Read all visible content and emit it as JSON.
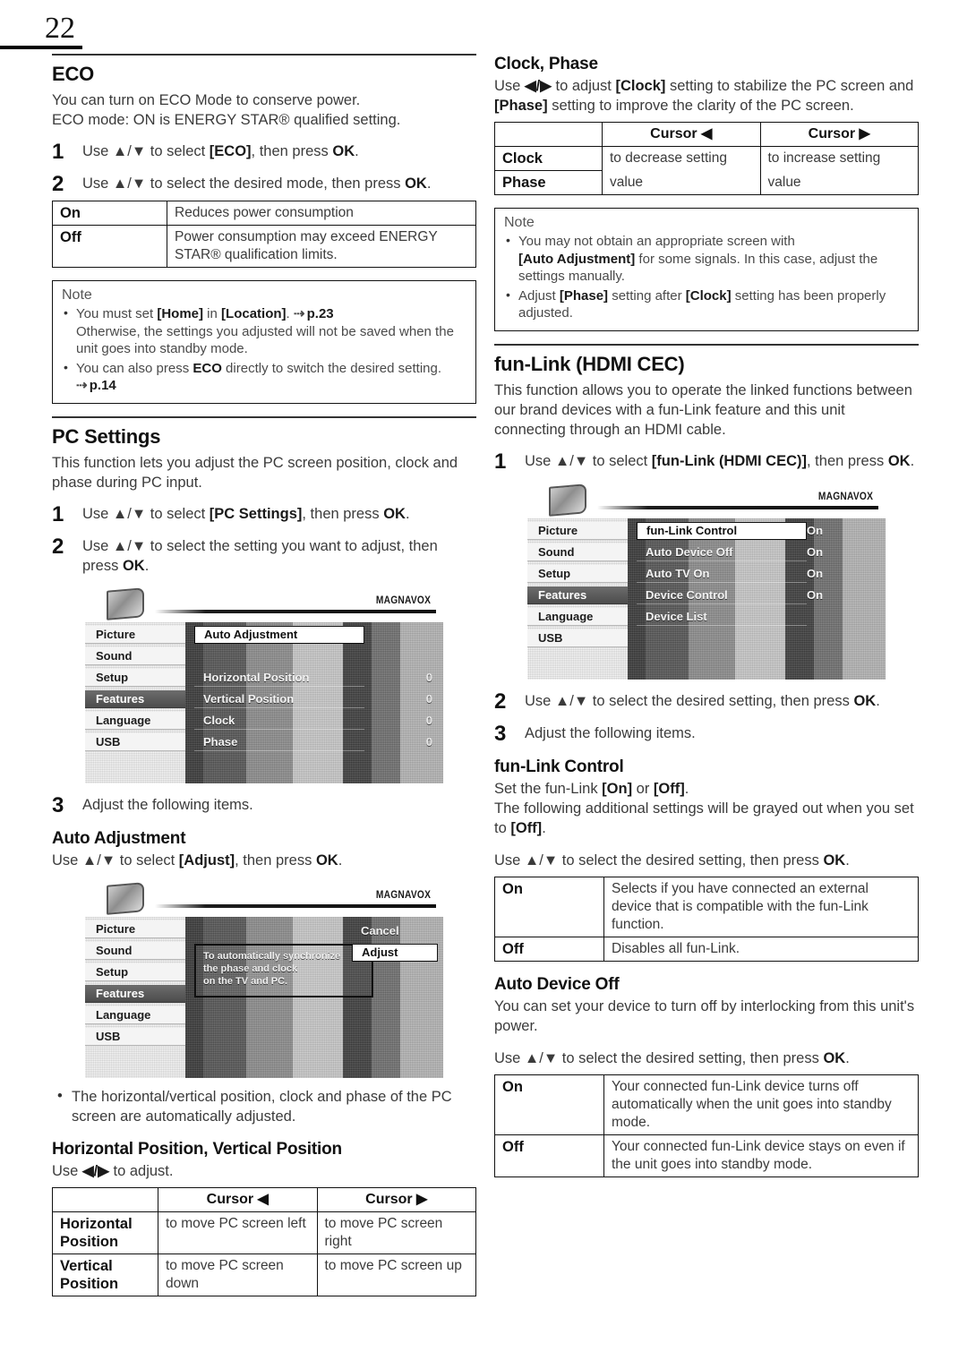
{
  "page": {
    "number": "22"
  },
  "left": {
    "eco": {
      "title": "ECO",
      "intro_line1": "You can turn on ECO Mode to conserve power.",
      "intro_line2": "ECO mode: ON is ENERGY STAR® qualified setting.",
      "steps": [
        {
          "num": "1",
          "text_pre": "Use ▲/▼ to select ",
          "bold1": "[ECO]",
          "text_mid": ", then press ",
          "bold2": "OK",
          "text_post": "."
        },
        {
          "num": "2",
          "text_pre": "Use ▲/▼ to select the desired mode, then press ",
          "bold1": "",
          "text_mid": "",
          "bold2": "OK",
          "text_post": "."
        }
      ],
      "table": {
        "rows": [
          {
            "label": "On",
            "desc": "Reduces power consumption"
          },
          {
            "label": "Off",
            "desc": "Power consumption may exceed ENERGY STAR® qualification limits."
          }
        ]
      },
      "note": {
        "heading": "Note",
        "items": [
          {
            "parts": "You must set [Home] in [Location]. ⇨ p.23 Otherwise, the settings you adjusted will not be saved when the unit goes into standby mode."
          },
          {
            "parts": "You can also press ECO directly to switch the desired setting. ⇨ p.14"
          }
        ]
      }
    },
    "pc_settings": {
      "title": "PC Settings",
      "intro": "This function lets you adjust the PC screen position, clock and phase during PC input.",
      "step1": "Use ▲/▼ to select [PC Settings], then press OK.",
      "step2": "Use ▲/▼ to select the setting you want to adjust, then press OK.",
      "step3": "Adjust the following items.",
      "step_nums": {
        "one": "1",
        "two": "2",
        "three": "3"
      }
    },
    "tv_pc": {
      "brand": "MAGNAVOX",
      "sidebar": [
        "Picture",
        "Sound",
        "Setup",
        "Features",
        "Language",
        "USB"
      ],
      "selected_sidebar": "Features",
      "rows": [
        "Auto Adjustment",
        "Horizontal Position",
        "Vertical Position",
        "Clock",
        "Phase"
      ],
      "highlighted_row": "Auto Adjustment",
      "values": [
        "",
        "0",
        "0",
        "0",
        "0"
      ]
    },
    "auto_adjustment": {
      "title": "Auto Adjustment",
      "line": "Use ▲/▼ to select [Adjust], then press OK.",
      "bullet": "The horizontal/vertical position, clock and phase of the PC screen are automatically adjusted."
    },
    "tv_adjust": {
      "brand": "MAGNAVOX",
      "sidebar": [
        "Picture",
        "Sound",
        "Setup",
        "Features",
        "Language",
        "USB"
      ],
      "selected_sidebar": "Features",
      "tooltip_line1": "To automatically synchronize",
      "tooltip_line2": "the phase and clock",
      "tooltip_line3": "on the TV and PC.",
      "buttons": [
        "Cancel",
        "Adjust"
      ],
      "highlighted_button": "Adjust"
    },
    "hv_position": {
      "title": "Horizontal Position, Vertical Position",
      "line": "Use ◀/▶ to adjust.",
      "table": {
        "headers": [
          "",
          "Cursor ◀",
          "Cursor ▶"
        ],
        "rows": [
          {
            "label": "Horizontal Position",
            "left": "to move PC screen left",
            "right": "to move PC screen right"
          },
          {
            "label": "Vertical Position",
            "left": "to move PC screen down",
            "right": "to move PC screen up"
          }
        ]
      }
    }
  },
  "right": {
    "clock_phase": {
      "title": "Clock, Phase",
      "intro": "Use ◀/▶ to adjust [Clock] setting to stabilize the PC screen and [Phase] setting to improve the clarity of the PC screen.",
      "table": {
        "headers": [
          "",
          "Cursor ◀",
          "Cursor ▶"
        ],
        "rows": [
          {
            "label": "Clock",
            "left": "to decrease setting",
            "right": "to increase setting"
          },
          {
            "label": "Phase",
            "left": "value",
            "right": "value"
          }
        ]
      },
      "note": {
        "heading": "Note",
        "items": [
          "You may not obtain an appropriate screen with [Auto Adjustment] for some signals. In this case, adjust the settings manually.",
          "Adjust [Phase] setting after [Clock] setting has been properly adjusted."
        ]
      }
    },
    "funlink": {
      "title": "fun-Link (HDMI CEC)",
      "intro": "This function allows you to operate the linked functions between our brand devices with a fun-Link feature and this unit connecting through an HDMI cable.",
      "step1": "Use ▲/▼ to select [fun-Link (HDMI CEC)], then press OK.",
      "step2": "Use ▲/▼ to select the desired setting, then press OK.",
      "step3": "Adjust the following items.",
      "step_nums": {
        "one": "1",
        "two": "2",
        "three": "3"
      }
    },
    "tv_funlink": {
      "brand": "MAGNAVOX",
      "sidebar": [
        "Picture",
        "Sound",
        "Setup",
        "Features",
        "Language",
        "USB"
      ],
      "selected_sidebar": "Features",
      "rows": [
        "fun-Link Control",
        "Auto Device Off",
        "Auto TV On",
        "Device Control",
        "Device List"
      ],
      "highlighted_row": "fun-Link Control",
      "values": [
        "On",
        "On",
        "On",
        "On",
        ""
      ]
    },
    "funlink_control": {
      "title": "fun-Link Control",
      "line1": "Set the fun-Link [On] or [Off].",
      "line2": "The following additional settings will be grayed out when you set to [Off].",
      "select_line": "Use ▲/▼ to select the desired setting, then press OK.",
      "table": {
        "rows": [
          {
            "label": "On",
            "desc": "Selects if you have connected an external device that is compatible with the fun-Link function."
          },
          {
            "label": "Off",
            "desc": "Disables all fun-Link."
          }
        ]
      }
    },
    "auto_device_off": {
      "title": "Auto Device Off",
      "intro": "You can set your device to turn off by interlocking from this unit's power.",
      "select_line": "Use ▲/▼ to select the desired setting, then press OK.",
      "table": {
        "rows": [
          {
            "label": "On",
            "desc": "Your connected fun-Link device turns off automatically when the unit goes into standby mode."
          },
          {
            "label": "Off",
            "desc": "Your connected fun-Link device stays on even if the unit goes into standby mode."
          }
        ]
      }
    }
  }
}
